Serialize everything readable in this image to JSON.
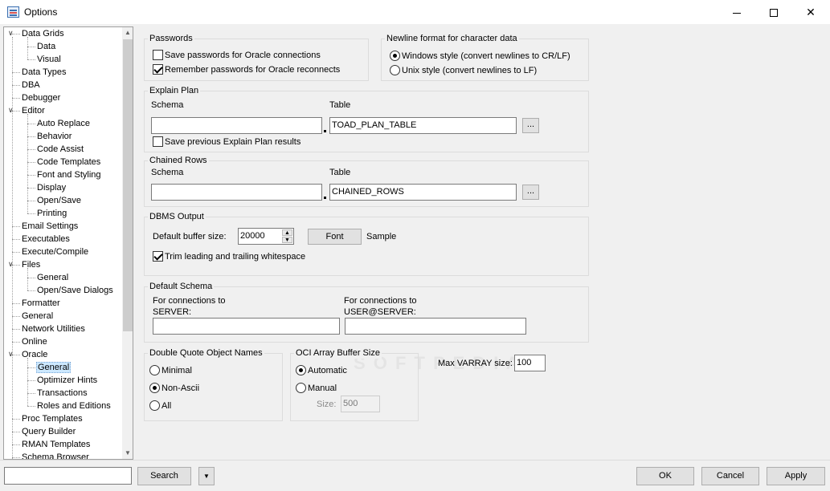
{
  "window": {
    "title": "Options",
    "controls": [
      "minimize-icon",
      "maximize-icon",
      "close-icon"
    ]
  },
  "tree": {
    "items": [
      {
        "label": "Data Grids",
        "level": 0,
        "expander": "expanded"
      },
      {
        "label": "Data",
        "level": 1
      },
      {
        "label": "Visual",
        "level": 1
      },
      {
        "label": "Data Types",
        "level": 0
      },
      {
        "label": "DBA",
        "level": 0
      },
      {
        "label": "Debugger",
        "level": 0
      },
      {
        "label": "Editor",
        "level": 0,
        "expander": "expanded"
      },
      {
        "label": "Auto Replace",
        "level": 1
      },
      {
        "label": "Behavior",
        "level": 1
      },
      {
        "label": "Code Assist",
        "level": 1
      },
      {
        "label": "Code Templates",
        "level": 1
      },
      {
        "label": "Font and Styling",
        "level": 1
      },
      {
        "label": "Display",
        "level": 1
      },
      {
        "label": "Open/Save",
        "level": 1
      },
      {
        "label": "Printing",
        "level": 1
      },
      {
        "label": "Email Settings",
        "level": 0
      },
      {
        "label": "Executables",
        "level": 0
      },
      {
        "label": "Execute/Compile",
        "level": 0
      },
      {
        "label": "Files",
        "level": 0,
        "expander": "expanded"
      },
      {
        "label": "General",
        "level": 1
      },
      {
        "label": "Open/Save Dialogs",
        "level": 1
      },
      {
        "label": "Formatter",
        "level": 0
      },
      {
        "label": "General",
        "level": 0
      },
      {
        "label": "Network Utilities",
        "level": 0
      },
      {
        "label": "Online",
        "level": 0
      },
      {
        "label": "Oracle",
        "level": 0,
        "expander": "expanded"
      },
      {
        "label": "General",
        "level": 1,
        "selected": true
      },
      {
        "label": "Optimizer Hints",
        "level": 1
      },
      {
        "label": "Transactions",
        "level": 1
      },
      {
        "label": "Roles and Editions",
        "level": 1
      },
      {
        "label": "Proc Templates",
        "level": 0
      },
      {
        "label": "Query Builder",
        "level": 0
      },
      {
        "label": "RMAN Templates",
        "level": 0
      },
      {
        "label": "Schema Browser",
        "level": 0
      }
    ]
  },
  "passwords": {
    "title": "Passwords",
    "save_label": "Save passwords for Oracle connections",
    "save_checked": false,
    "remember_label": "Remember passwords for Oracle reconnects",
    "remember_checked": true
  },
  "newline": {
    "title": "Newline format for character data",
    "windows_label": "Windows style (convert newlines to CR/LF)",
    "unix_label": "Unix style (convert newlines to LF)",
    "selected": "windows"
  },
  "explain_plan": {
    "title": "Explain Plan",
    "schema_label": "Schema",
    "table_label": "Table",
    "schema_value": "",
    "table_value": "TOAD_PLAN_TABLE",
    "browse_label": "...",
    "save_label": "Save previous Explain Plan results",
    "save_checked": false
  },
  "chained_rows": {
    "title": "Chained Rows",
    "schema_label": "Schema",
    "table_label": "Table",
    "schema_value": "",
    "table_value": "CHAINED_ROWS",
    "browse_label": "..."
  },
  "dbms_output": {
    "title": "DBMS Output",
    "buffer_label": "Default buffer size:",
    "buffer_value": "20000",
    "font_button": "Font",
    "sample_label": "Sample",
    "trim_label": "Trim leading and trailing whitespace",
    "trim_checked": true
  },
  "default_schema": {
    "title": "Default Schema",
    "server_label_1": "For connections to",
    "server_label_2": "SERVER:",
    "user_label_1": "For connections to",
    "user_label_2": "USER@SERVER:",
    "server_value": "",
    "user_value": ""
  },
  "double_quote": {
    "title": "Double Quote Object Names",
    "options": [
      "Minimal",
      "Non-Ascii",
      "All"
    ],
    "selected": "Non-Ascii"
  },
  "oci_array": {
    "title": "OCI Array Buffer Size",
    "automatic_label": "Automatic",
    "manual_label": "Manual",
    "selected": "Automatic",
    "size_label": "Size:",
    "size_value": "500"
  },
  "varray": {
    "label": "Max VARRAY size:",
    "value": "100"
  },
  "bottom": {
    "search_value": "",
    "search_button": "Search",
    "ok_button": "OK",
    "cancel_button": "Cancel",
    "apply_button": "Apply"
  }
}
